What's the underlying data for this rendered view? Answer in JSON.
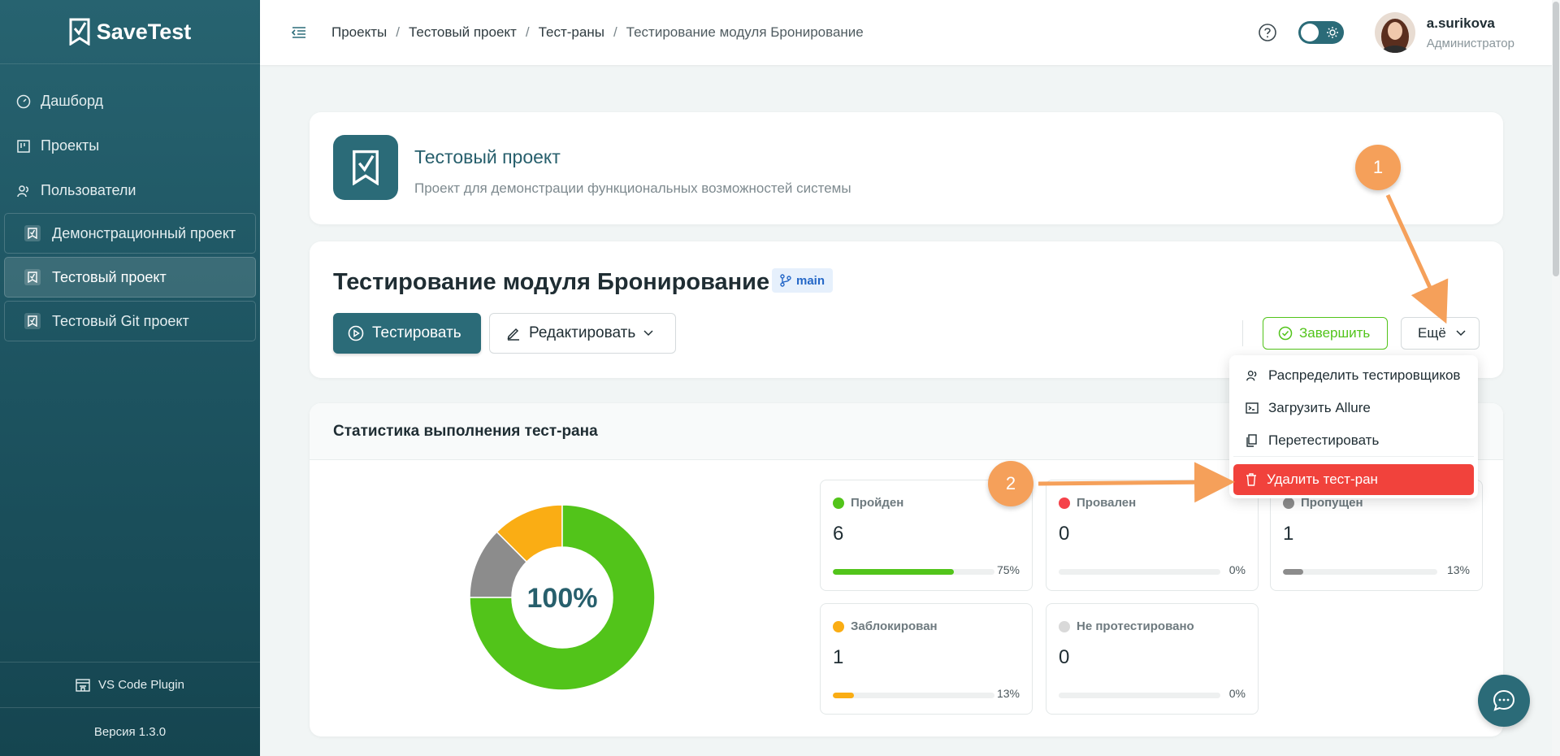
{
  "app": {
    "name": "SaveTest",
    "version": "Версия 1.3.0",
    "plugin": "VS Code Plugin"
  },
  "sidebar": {
    "nav": [
      {
        "label": "Дашборд",
        "icon": "dashboard-icon"
      },
      {
        "label": "Проекты",
        "icon": "projects-icon"
      },
      {
        "label": "Пользователи",
        "icon": "users-icon"
      }
    ],
    "projects": [
      {
        "label": "Демонстрационный проект",
        "active": false
      },
      {
        "label": "Тестовый проект",
        "active": true
      },
      {
        "label": "Тестовый Git проект",
        "active": false
      }
    ]
  },
  "header": {
    "breadcrumb": [
      "Проекты",
      "Тестовый проект",
      "Тест-раны",
      "Тестирование модуля Бронирование"
    ],
    "user": {
      "name": "a.surikova",
      "role": "Администратор"
    }
  },
  "project": {
    "name": "Тестовый проект",
    "description": "Проект для демонстрации функциональных возможностей системы"
  },
  "run": {
    "title": "Тестирование модуля Бронирование",
    "branch": "main",
    "buttons": {
      "test": "Тестировать",
      "edit": "Редактировать",
      "finish": "Завершить",
      "more": "Ещё"
    }
  },
  "dropdown": {
    "items": [
      "Распределить тестировщиков",
      "Загрузить Allure",
      "Перетестировать"
    ],
    "danger": "Удалить тест-ран"
  },
  "stats": {
    "title": "Статистика выполнения тест-рана",
    "center": "100%",
    "items": [
      {
        "label": "Пройден",
        "value": "6",
        "pct": "75%",
        "fraction": 0.75,
        "color": "#52c41a"
      },
      {
        "label": "Провален",
        "value": "0",
        "pct": "0%",
        "fraction": 0,
        "color": "#f5424a"
      },
      {
        "label": "Пропущен",
        "value": "1",
        "pct": "13%",
        "fraction": 0.13,
        "color": "#8c8c8c"
      },
      {
        "label": "Заблокирован",
        "value": "1",
        "pct": "13%",
        "fraction": 0.13,
        "color": "#faad14"
      },
      {
        "label": "Не протестировано",
        "value": "0",
        "pct": "0%",
        "fraction": 0,
        "color": "#d9d9d9"
      }
    ]
  },
  "annotations": {
    "m1": "1",
    "m2": "2"
  }
}
